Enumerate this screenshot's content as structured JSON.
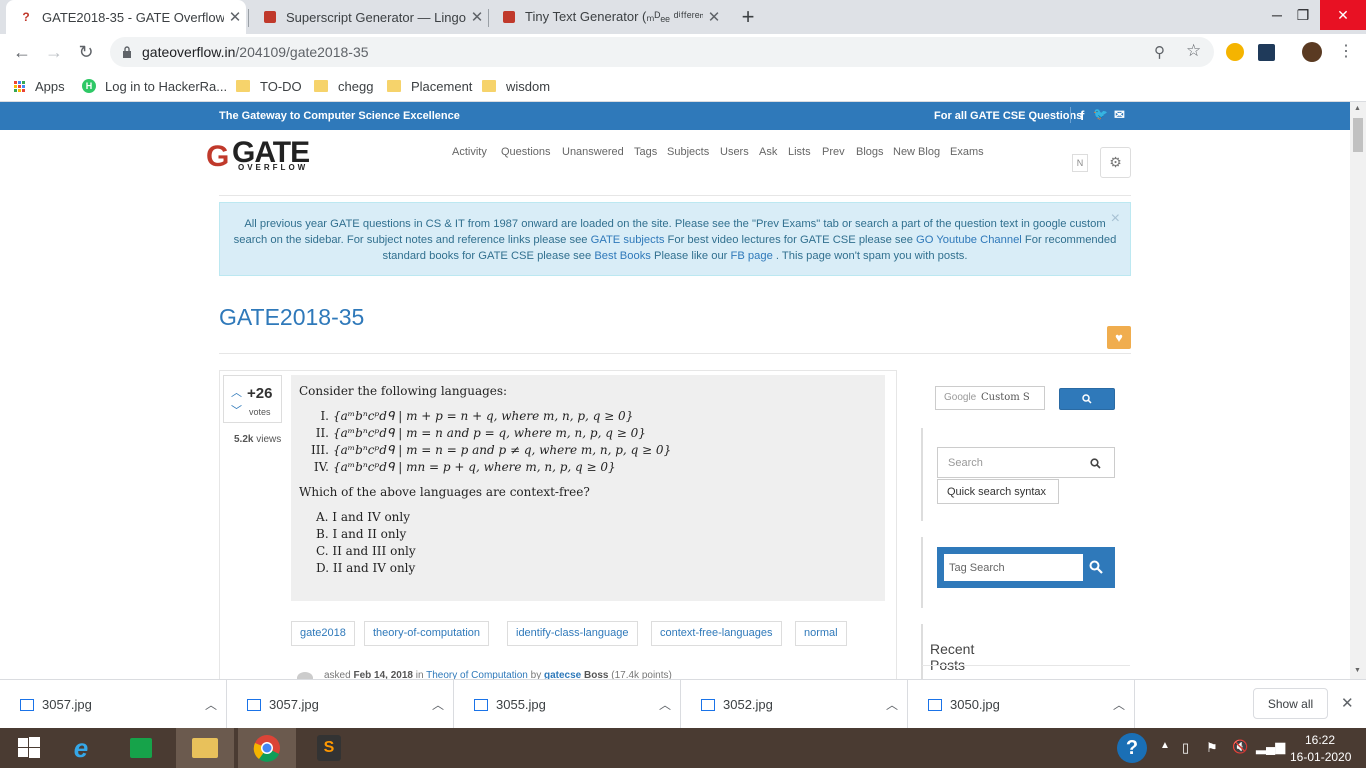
{
  "browser": {
    "tabs": [
      {
        "title": "GATE2018-35 - GATE Overflow",
        "active": true
      },
      {
        "title": "Superscript Generator — LingoJa",
        "active": false
      },
      {
        "title": "Tiny Text Generator (ₘᴰₑₑ ᵈⁱᶠᶠᵉʳᵉⁿᵗ ᵗ",
        "active": false
      }
    ],
    "url_host": "gateoverflow.in",
    "url_path": "/204109/gate2018-35",
    "bookmarks": [
      "Apps",
      "Log in to HackerRa...",
      "TO-DO",
      "chegg",
      "Placement",
      "wisdom"
    ]
  },
  "site": {
    "tagline": "The Gateway to Computer Science Excellence",
    "top_right": "For all GATE CSE Questions",
    "logo_main": "GATE",
    "logo_sub": "OVERFLOW",
    "nav": [
      "Activity",
      "Questions",
      "Unanswered",
      "Tags",
      "Subjects",
      "Users",
      "Ask",
      "Lists",
      "Prev",
      "Blogs",
      "New Blog",
      "Exams"
    ],
    "notif_badge": "N"
  },
  "alert": {
    "part1": "All previous year GATE questions in CS & IT from 1987 onward are loaded on the site. Please see the \"Prev Exams\" tab or search a part of the question text in google custom search on the sidebar. For subject notes and reference links please see ",
    "link1": "GATE subjects",
    "part2": " For best video lectures for GATE CSE please see ",
    "link2": "GO Youtube Channel",
    "part3": " For recommended standard books for GATE CSE please see ",
    "link3": "Best Books",
    "part4": " Please like our ",
    "link4": "FB page",
    "part5": " . This page won't spam you with posts.",
    "close": "×"
  },
  "question": {
    "title": "GATE2018-35",
    "votes": "+26",
    "votes_label": "votes",
    "views_count": "5.2k",
    "views_label": "views",
    "intro": "Consider the following languages:",
    "languages": [
      {
        "num": "I.",
        "expr": "{aᵐbⁿcᵖdᑫ | m + p = n + q,  where m, n, p, q ≥ 0}"
      },
      {
        "num": "II.",
        "expr": "{aᵐbⁿcᵖdᑫ | m = n and p = q,  where m, n, p, q ≥ 0}"
      },
      {
        "num": "III.",
        "expr": "{aᵐbⁿcᵖdᑫ | m = n = p and p ≠ q,  where m, n, p, q ≥ 0}"
      },
      {
        "num": "IV.",
        "expr": "{aᵐbⁿcᵖdᑫ | mn = p + q,  where m, n, p, q ≥ 0}"
      }
    ],
    "prompt": "Which of the above languages are context-free?",
    "options": [
      "A. I and IV only",
      "B. I and II only",
      "C. II and III only",
      "D. II and IV only"
    ],
    "tags": [
      "gate2018",
      "theory-of-computation",
      "identify-class-language",
      "context-free-languages",
      "normal"
    ],
    "meta_asked": "asked",
    "meta_date": "Feb 14, 2018",
    "meta_in": "in",
    "meta_category": "Theory of Computation",
    "meta_by": "by",
    "meta_user": "gatecse",
    "meta_rank": "Boss",
    "meta_points": "(17.4k points)"
  },
  "sidebar": {
    "google_label": "Google",
    "google_placeholder": "Custom S",
    "search_placeholder": "Search",
    "quick_search": "Quick search syntax",
    "tag_search_placeholder": "Tag Search",
    "recent_posts": "Recent Posts"
  },
  "downloads": {
    "files": [
      "3057.jpg",
      "3057.jpg",
      "3055.jpg",
      "3052.jpg",
      "3050.jpg"
    ],
    "show_all": "Show all"
  },
  "taskbar": {
    "time": "16:22",
    "date": "16-01-2020"
  },
  "colors": {
    "brand": "#2f79ba",
    "alert_bg": "#d9edf7",
    "favorite": "#f0ad4e"
  }
}
